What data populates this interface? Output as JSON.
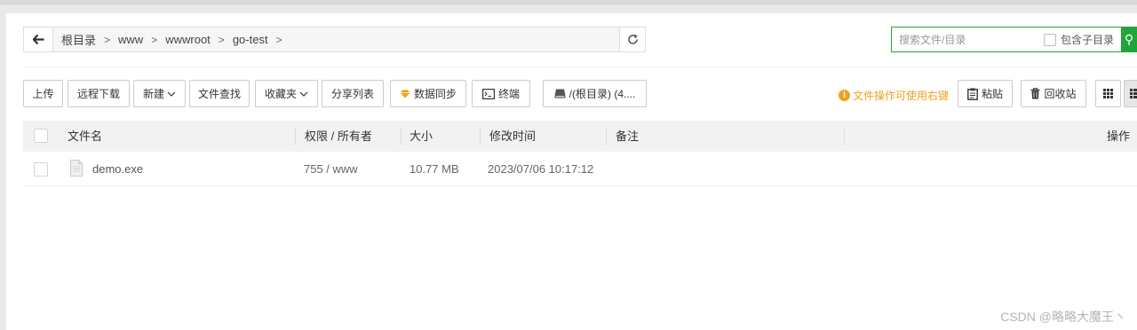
{
  "path": {
    "crumbs": [
      "根目录",
      "www",
      "wwwroot",
      "go-test"
    ],
    "separator": ">",
    "back_icon": "arrow-left-icon",
    "refresh_icon": "refresh-icon"
  },
  "search": {
    "placeholder": "搜索文件/目录",
    "include_subdir_label": "包含子目录",
    "include_subdir_checked": false,
    "button_icon": "search-icon",
    "accent": "#20a53a"
  },
  "toolbar": {
    "upload": "上传",
    "remote_download": "远程下载",
    "new": "新建",
    "file_find": "文件查找",
    "favorites": "收藏夹",
    "share_list": "分享列表",
    "sync": "数据同步",
    "terminal": "终端",
    "disk": "/(根目录) (4....",
    "tip": "文件操作可使用右键",
    "paste": "粘贴",
    "recycle": "回收站",
    "tip_color": "#f0a020",
    "sync_icon_color": "#f0a020"
  },
  "table": {
    "headers": {
      "name": "文件名",
      "perm": "权限 / 所有者",
      "size": "大小",
      "mtime": "修改时间",
      "note": "备注",
      "ops": "操作"
    },
    "rows": [
      {
        "name": "demo.exe",
        "perm": "755 / www",
        "size": "10.77 MB",
        "mtime": "2023/07/06 10:17:12",
        "note": ""
      }
    ]
  },
  "watermark": "CSDN @略略大魔王丶"
}
